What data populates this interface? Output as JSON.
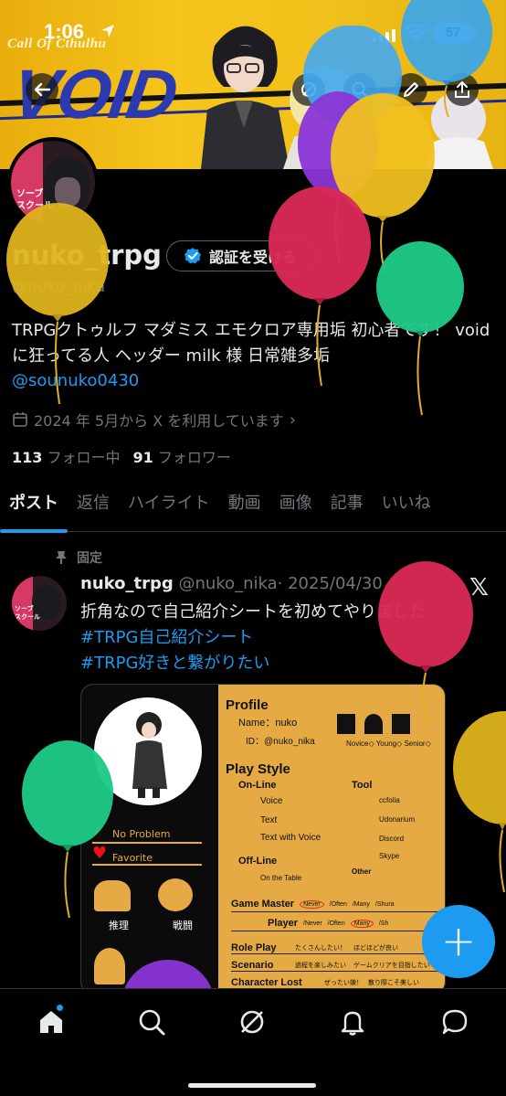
{
  "status_bar": {
    "time": "1:06",
    "battery": "57"
  },
  "banner": {
    "subtitle": "Call Of Cthulhu",
    "logo": "VOID"
  },
  "avatar": {
    "text_line1": "ソーブ",
    "text_line2": "スクール"
  },
  "profile": {
    "name": "nuko_trpg",
    "verify_label": "認証を受ける",
    "handle": "@nuko_nika",
    "bio": "TRPGクトゥルフ マダミス エモクロア専用垢 初心者です！ voidに狂ってる人 ヘッダー milk 様 日常雑多垢",
    "bio_link": "@sounuko0430",
    "joined": "2024 年 5月から X を利用しています",
    "following_count": "113",
    "following_label": "フォロー中",
    "followers_count": "91",
    "followers_label": "フォロワー"
  },
  "tabs": [
    {
      "label": "ポスト"
    },
    {
      "label": "返信"
    },
    {
      "label": "ハイライト"
    },
    {
      "label": "動画"
    },
    {
      "label": "画像"
    },
    {
      "label": "記事"
    },
    {
      "label": "いいね"
    }
  ],
  "post": {
    "pinned_label": "固定",
    "author_name": "nuko_trpg",
    "author_handle": "@nuko_nika",
    "date": "· 2025/04/30",
    "text": "折角なので自己紹介シートを初めてやりました",
    "tags": [
      "#TRPG自己紹介シート",
      "#TRPG好きと繋がりたい"
    ]
  },
  "sheet": {
    "profile_heading": "Profile",
    "name_label": "Name：nuko",
    "id_label": "ID：@nuko_nika",
    "play_style_heading": "Play Style",
    "online": "On-Line",
    "online_items": [
      "Voice",
      "Text",
      "Text with Voice"
    ],
    "tool": "Tool",
    "tool_items": [
      "ccfolia",
      "Udonarium",
      "Discord",
      "Skype"
    ],
    "offline": "Off-Line",
    "offline_item": "On the Table",
    "other": "Other",
    "levels": [
      "Novice",
      "Young",
      "Senior"
    ],
    "gm_label": "Game Master",
    "player_label": "Player",
    "gm_opts": [
      "Never",
      "/Often",
      "/Many",
      "/Shura"
    ],
    "player_opts": [
      "/Never",
      "/Often",
      "Many",
      "/Sh"
    ],
    "role_play": "Role Play",
    "role_play_opts": "たくさんしたい！",
    "role_play_opts2": "ほどほどが良い",
    "scenario": "Scenario",
    "scenario_opts": "過程を楽しみたい",
    "scenario_opts2": "ゲームクリアを目指したい",
    "lost": "Character Lost",
    "lost_opts": "ぜったい嫌！",
    "lost_opts2": "散り際こそ美しい",
    "no_problem": "No Problem",
    "favorite": "Favorite",
    "reasoning": "推理",
    "battle": "戦闘"
  },
  "colors": {
    "accent": "#1d9bf0",
    "banner": "#f1c01a",
    "sheet": "#e5aa43"
  }
}
